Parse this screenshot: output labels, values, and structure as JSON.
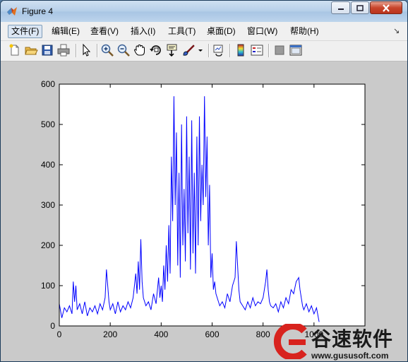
{
  "window": {
    "title": "Figure 4"
  },
  "menus": [
    "文件(F)",
    "编辑(E)",
    "查看(V)",
    "插入(I)",
    "工具(T)",
    "桌面(D)",
    "窗口(W)",
    "帮助(H)"
  ],
  "toolbar": {
    "icons": [
      "new-figure-icon",
      "open-file-icon",
      "save-icon",
      "print-icon",
      "pointer-icon",
      "zoom-in-icon",
      "zoom-out-icon",
      "pan-hand-icon",
      "rotate-3d-icon",
      "data-cursor-icon",
      "brush-icon",
      "link-plot-icon",
      "colorbar-icon",
      "legend-icon",
      "hide-plot-tools-icon",
      "show-plot-tools-icon"
    ]
  },
  "colors": {
    "line": "#0000ff",
    "figure_bg": "#cacaca",
    "axes_bg": "#ffffff"
  },
  "chart_data": {
    "type": "line",
    "title": "",
    "xlabel": "",
    "ylabel": "",
    "xlim": [
      0,
      1200
    ],
    "ylim": [
      0,
      600
    ],
    "xticks": [
      0,
      200,
      400,
      600,
      800,
      1000
    ],
    "xtick_labels": [
      "0",
      "200",
      "400",
      "600",
      "800",
      "1000"
    ],
    "yticks": [
      0,
      100,
      200,
      300,
      400,
      500,
      600
    ],
    "ytick_labels": [
      "0",
      "100",
      "200",
      "300",
      "400",
      "500",
      "600"
    ],
    "grid": false,
    "series": [
      {
        "color": "#0000ff",
        "x": [
          0,
          10,
          20,
          30,
          40,
          50,
          55,
          60,
          65,
          70,
          80,
          90,
          100,
          110,
          120,
          130,
          140,
          150,
          160,
          170,
          180,
          185,
          190,
          195,
          200,
          210,
          220,
          230,
          240,
          250,
          260,
          270,
          280,
          290,
          300,
          305,
          310,
          315,
          320,
          325,
          330,
          340,
          350,
          360,
          370,
          380,
          390,
          395,
          400,
          405,
          410,
          415,
          420,
          425,
          430,
          435,
          440,
          445,
          450,
          455,
          460,
          465,
          470,
          475,
          480,
          485,
          490,
          495,
          500,
          505,
          510,
          515,
          520,
          525,
          530,
          535,
          540,
          545,
          550,
          555,
          560,
          565,
          570,
          575,
          580,
          585,
          590,
          595,
          600,
          605,
          610,
          615,
          620,
          630,
          640,
          650,
          660,
          670,
          680,
          690,
          695,
          700,
          705,
          710,
          720,
          730,
          740,
          750,
          760,
          770,
          780,
          790,
          800,
          810,
          815,
          820,
          825,
          830,
          840,
          850,
          860,
          870,
          880,
          890,
          900,
          910,
          920,
          930,
          940,
          945,
          950,
          955,
          960,
          970,
          980,
          990,
          1000,
          1010,
          1020
        ],
        "y": [
          55,
          20,
          45,
          35,
          50,
          30,
          110,
          60,
          100,
          40,
          55,
          30,
          60,
          25,
          45,
          35,
          50,
          30,
          55,
          40,
          70,
          140,
          100,
          60,
          40,
          55,
          30,
          60,
          35,
          50,
          40,
          60,
          45,
          70,
          130,
          80,
          160,
          90,
          215,
          110,
          70,
          50,
          60,
          40,
          80,
          55,
          120,
          70,
          100,
          60,
          150,
          90,
          200,
          110,
          250,
          130,
          420,
          260,
          570,
          300,
          480,
          150,
          380,
          120,
          500,
          200,
          340,
          160,
          520,
          230,
          420,
          140,
          510,
          180,
          380,
          130,
          470,
          200,
          520,
          260,
          400,
          300,
          570,
          320,
          470,
          200,
          350,
          120,
          180,
          90,
          110,
          80,
          70,
          50,
          60,
          45,
          80,
          60,
          100,
          120,
          210,
          150,
          90,
          60,
          50,
          40,
          60,
          45,
          70,
          50,
          60,
          55,
          70,
          110,
          140,
          90,
          60,
          50,
          45,
          55,
          35,
          60,
          45,
          70,
          55,
          90,
          80,
          110,
          120,
          90,
          70,
          50,
          40,
          55,
          35,
          50,
          30,
          45,
          10
        ]
      }
    ]
  },
  "watermark": {
    "name": "谷速软件",
    "url": "www.gususoft.com"
  }
}
